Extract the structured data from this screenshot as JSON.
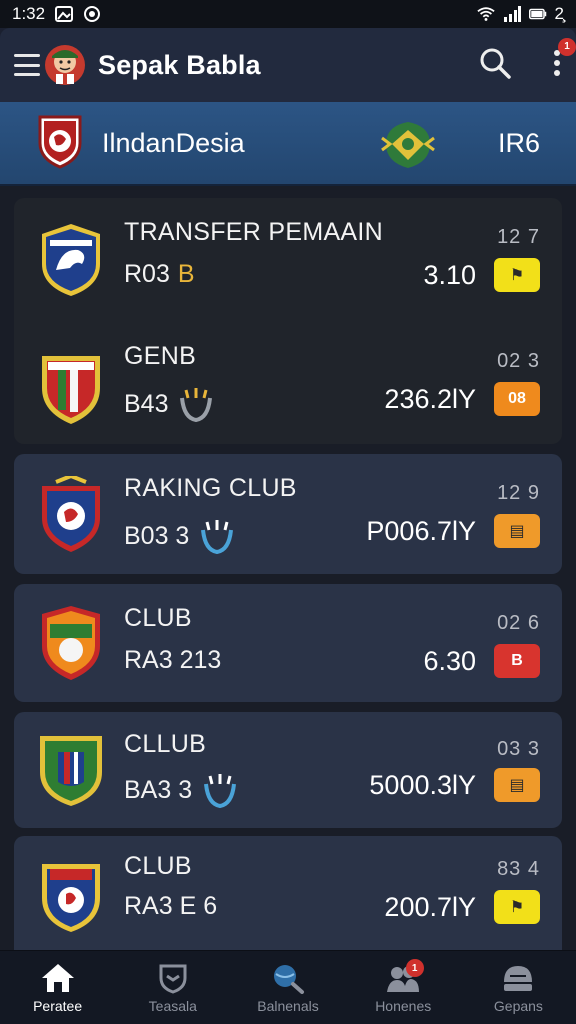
{
  "status_bar": {
    "time": "1:32",
    "battery_text": "2̧̧",
    "icons": [
      "image-icon",
      "circle-icon",
      "wifi-icon",
      "signal-icon",
      "battery-icon"
    ]
  },
  "header": {
    "title": "Sepak Babla",
    "menu_icon": "hamburger-icon",
    "search_icon": "search-icon",
    "more_icon": "more-vertical-icon",
    "more_badge": "1"
  },
  "league": {
    "name": "IlndanDesia",
    "code": "IR6"
  },
  "rows": [
    {
      "title": "TRANSFER PEMAAIN",
      "sub": "R03",
      "sub_extra": "B",
      "time": "12 7",
      "value": "3.10",
      "badge_color": "#f2e019",
      "badge_text": "⚑"
    },
    {
      "title": "GENB",
      "sub": "B43",
      "sub_extra": "",
      "time": "02 3",
      "value": "236.2lY",
      "badge_color": "#ef8a1d",
      "badge_text": "08"
    },
    {
      "title": "RAKING CLUB",
      "sub": "B03 3",
      "sub_extra": "",
      "time": "12 9",
      "value": "P006.7lY",
      "badge_color": "#ef9a2a",
      "badge_text": "▤"
    },
    {
      "title": "CLUB",
      "sub": "RA3 213",
      "sub_extra": "",
      "time": "02 6",
      "value": "6.30",
      "badge_color": "#d8342e",
      "badge_text": "B"
    },
    {
      "title": "CLLUB",
      "sub": "BA3 3",
      "sub_extra": "",
      "time": "03 3",
      "value": "5000.3lY",
      "badge_color": "#ef9a2a",
      "badge_text": "▤"
    },
    {
      "title": "CLUB",
      "sub": "RA3 E 6",
      "sub_extra": "",
      "time": "83 4",
      "value": "200.7lY",
      "badge_color": "#f2e019",
      "badge_text": "⚑"
    }
  ],
  "bottom_nav": [
    {
      "label": "Peratee",
      "icon": "home-icon",
      "active": true
    },
    {
      "label": "Teasala",
      "icon": "shield-icon",
      "active": false
    },
    {
      "label": "Balnenals",
      "icon": "search-globe-icon",
      "active": false
    },
    {
      "label": "Honenes",
      "icon": "people-icon",
      "active": false,
      "badge": "1"
    },
    {
      "label": "Gepans",
      "icon": "helmet-icon",
      "active": false
    }
  ]
}
